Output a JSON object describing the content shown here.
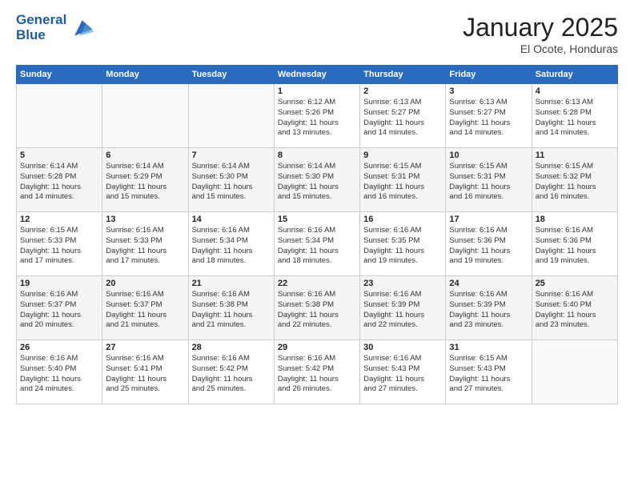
{
  "logo": {
    "line1": "General",
    "line2": "Blue"
  },
  "title": "January 2025",
  "subtitle": "El Ocote, Honduras",
  "header_days": [
    "Sunday",
    "Monday",
    "Tuesday",
    "Wednesday",
    "Thursday",
    "Friday",
    "Saturday"
  ],
  "weeks": [
    [
      {
        "day": "",
        "info": ""
      },
      {
        "day": "",
        "info": ""
      },
      {
        "day": "",
        "info": ""
      },
      {
        "day": "1",
        "info": "Sunrise: 6:12 AM\nSunset: 5:26 PM\nDaylight: 11 hours\nand 13 minutes."
      },
      {
        "day": "2",
        "info": "Sunrise: 6:13 AM\nSunset: 5:27 PM\nDaylight: 11 hours\nand 14 minutes."
      },
      {
        "day": "3",
        "info": "Sunrise: 6:13 AM\nSunset: 5:27 PM\nDaylight: 11 hours\nand 14 minutes."
      },
      {
        "day": "4",
        "info": "Sunrise: 6:13 AM\nSunset: 5:28 PM\nDaylight: 11 hours\nand 14 minutes."
      }
    ],
    [
      {
        "day": "5",
        "info": "Sunrise: 6:14 AM\nSunset: 5:28 PM\nDaylight: 11 hours\nand 14 minutes."
      },
      {
        "day": "6",
        "info": "Sunrise: 6:14 AM\nSunset: 5:29 PM\nDaylight: 11 hours\nand 15 minutes."
      },
      {
        "day": "7",
        "info": "Sunrise: 6:14 AM\nSunset: 5:30 PM\nDaylight: 11 hours\nand 15 minutes."
      },
      {
        "day": "8",
        "info": "Sunrise: 6:14 AM\nSunset: 5:30 PM\nDaylight: 11 hours\nand 15 minutes."
      },
      {
        "day": "9",
        "info": "Sunrise: 6:15 AM\nSunset: 5:31 PM\nDaylight: 11 hours\nand 16 minutes."
      },
      {
        "day": "10",
        "info": "Sunrise: 6:15 AM\nSunset: 5:31 PM\nDaylight: 11 hours\nand 16 minutes."
      },
      {
        "day": "11",
        "info": "Sunrise: 6:15 AM\nSunset: 5:32 PM\nDaylight: 11 hours\nand 16 minutes."
      }
    ],
    [
      {
        "day": "12",
        "info": "Sunrise: 6:15 AM\nSunset: 5:33 PM\nDaylight: 11 hours\nand 17 minutes."
      },
      {
        "day": "13",
        "info": "Sunrise: 6:16 AM\nSunset: 5:33 PM\nDaylight: 11 hours\nand 17 minutes."
      },
      {
        "day": "14",
        "info": "Sunrise: 6:16 AM\nSunset: 5:34 PM\nDaylight: 11 hours\nand 18 minutes."
      },
      {
        "day": "15",
        "info": "Sunrise: 6:16 AM\nSunset: 5:34 PM\nDaylight: 11 hours\nand 18 minutes."
      },
      {
        "day": "16",
        "info": "Sunrise: 6:16 AM\nSunset: 5:35 PM\nDaylight: 11 hours\nand 19 minutes."
      },
      {
        "day": "17",
        "info": "Sunrise: 6:16 AM\nSunset: 5:36 PM\nDaylight: 11 hours\nand 19 minutes."
      },
      {
        "day": "18",
        "info": "Sunrise: 6:16 AM\nSunset: 5:36 PM\nDaylight: 11 hours\nand 19 minutes."
      }
    ],
    [
      {
        "day": "19",
        "info": "Sunrise: 6:16 AM\nSunset: 5:37 PM\nDaylight: 11 hours\nand 20 minutes."
      },
      {
        "day": "20",
        "info": "Sunrise: 6:16 AM\nSunset: 5:37 PM\nDaylight: 11 hours\nand 21 minutes."
      },
      {
        "day": "21",
        "info": "Sunrise: 6:16 AM\nSunset: 5:38 PM\nDaylight: 11 hours\nand 21 minutes."
      },
      {
        "day": "22",
        "info": "Sunrise: 6:16 AM\nSunset: 5:38 PM\nDaylight: 11 hours\nand 22 minutes."
      },
      {
        "day": "23",
        "info": "Sunrise: 6:16 AM\nSunset: 5:39 PM\nDaylight: 11 hours\nand 22 minutes."
      },
      {
        "day": "24",
        "info": "Sunrise: 6:16 AM\nSunset: 5:39 PM\nDaylight: 11 hours\nand 23 minutes."
      },
      {
        "day": "25",
        "info": "Sunrise: 6:16 AM\nSunset: 5:40 PM\nDaylight: 11 hours\nand 23 minutes."
      }
    ],
    [
      {
        "day": "26",
        "info": "Sunrise: 6:16 AM\nSunset: 5:40 PM\nDaylight: 11 hours\nand 24 minutes."
      },
      {
        "day": "27",
        "info": "Sunrise: 6:16 AM\nSunset: 5:41 PM\nDaylight: 11 hours\nand 25 minutes."
      },
      {
        "day": "28",
        "info": "Sunrise: 6:16 AM\nSunset: 5:42 PM\nDaylight: 11 hours\nand 25 minutes."
      },
      {
        "day": "29",
        "info": "Sunrise: 6:16 AM\nSunset: 5:42 PM\nDaylight: 11 hours\nand 26 minutes."
      },
      {
        "day": "30",
        "info": "Sunrise: 6:16 AM\nSunset: 5:43 PM\nDaylight: 11 hours\nand 27 minutes."
      },
      {
        "day": "31",
        "info": "Sunrise: 6:15 AM\nSunset: 5:43 PM\nDaylight: 11 hours\nand 27 minutes."
      },
      {
        "day": "",
        "info": ""
      }
    ]
  ]
}
